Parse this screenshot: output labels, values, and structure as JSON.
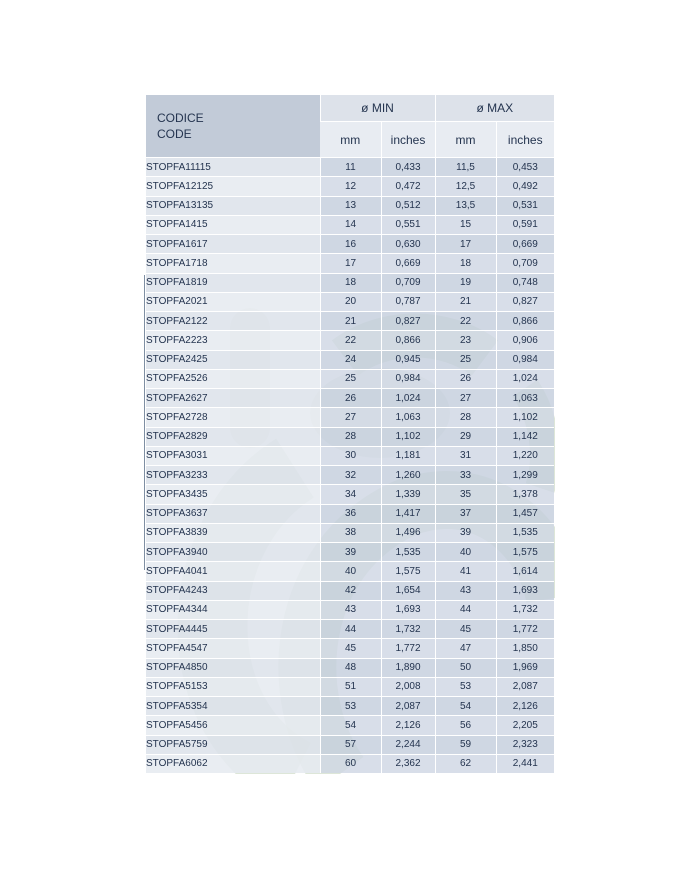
{
  "header": {
    "code_label_it": "CODICE",
    "code_label_en": "CODE",
    "min_label": "ø MIN",
    "max_label": "ø MAX",
    "unit_mm": "mm",
    "unit_inches": "inches"
  },
  "rows": [
    [
      "STOPFA11115",
      "11",
      "0,433",
      "11,5",
      "0,453"
    ],
    [
      "STOPFA12125",
      "12",
      "0,472",
      "12,5",
      "0,492"
    ],
    [
      "STOPFA13135",
      "13",
      "0,512",
      "13,5",
      "0,531"
    ],
    [
      "STOPFA1415",
      "14",
      "0,551",
      "15",
      "0,591"
    ],
    [
      "STOPFA1617",
      "16",
      "0,630",
      "17",
      "0,669"
    ],
    [
      "STOPFA1718",
      "17",
      "0,669",
      "18",
      "0,709"
    ],
    [
      "STOPFA1819",
      "18",
      "0,709",
      "19",
      "0,748"
    ],
    [
      "STOPFA2021",
      "20",
      "0,787",
      "21",
      "0,827"
    ],
    [
      "STOPFA2122",
      "21",
      "0,827",
      "22",
      "0,866"
    ],
    [
      "STOPFA2223",
      "22",
      "0,866",
      "23",
      "0,906"
    ],
    [
      "STOPFA2425",
      "24",
      "0,945",
      "25",
      "0,984"
    ],
    [
      "STOPFA2526",
      "25",
      "0,984",
      "26",
      "1,024"
    ],
    [
      "STOPFA2627",
      "26",
      "1,024",
      "27",
      "1,063"
    ],
    [
      "STOPFA2728",
      "27",
      "1,063",
      "28",
      "1,102"
    ],
    [
      "STOPFA2829",
      "28",
      "1,102",
      "29",
      "1,142"
    ],
    [
      "STOPFA3031",
      "30",
      "1,181",
      "31",
      "1,220"
    ],
    [
      "STOPFA3233",
      "32",
      "1,260",
      "33",
      "1,299"
    ],
    [
      "STOPFA3435",
      "34",
      "1,339",
      "35",
      "1,378"
    ],
    [
      "STOPFA3637",
      "36",
      "1,417",
      "37",
      "1,457"
    ],
    [
      "STOPFA3839",
      "38",
      "1,496",
      "39",
      "1,535"
    ],
    [
      "STOPFA3940",
      "39",
      "1,535",
      "40",
      "1,575"
    ],
    [
      "STOPFA4041",
      "40",
      "1,575",
      "41",
      "1,614"
    ],
    [
      "STOPFA4243",
      "42",
      "1,654",
      "43",
      "1,693"
    ],
    [
      "STOPFA4344",
      "43",
      "1,693",
      "44",
      "1,732"
    ],
    [
      "STOPFA4445",
      "44",
      "1,732",
      "45",
      "1,772"
    ],
    [
      "STOPFA4547",
      "45",
      "1,772",
      "47",
      "1,850"
    ],
    [
      "STOPFA4850",
      "48",
      "1,890",
      "50",
      "1,969"
    ],
    [
      "STOPFA5153",
      "51",
      "2,008",
      "53",
      "2,087"
    ],
    [
      "STOPFA5354",
      "53",
      "2,087",
      "54",
      "2,126"
    ],
    [
      "STOPFA5456",
      "54",
      "2,126",
      "56",
      "2,205"
    ],
    [
      "STOPFA5759",
      "57",
      "2,244",
      "59",
      "2,323"
    ],
    [
      "STOPFA6062",
      "60",
      "2,362",
      "62",
      "2,441"
    ]
  ],
  "colors": {
    "header_code_bg": "#c2cbd8",
    "header_group_bg": "#dde2ea",
    "header_unit_bg": "#e8ecf2",
    "code_cell_bg": "#dde3eb",
    "number_cell_bg": "#c4cedd",
    "text": "#24344f",
    "watermark_green": "#cfdcc8"
  }
}
